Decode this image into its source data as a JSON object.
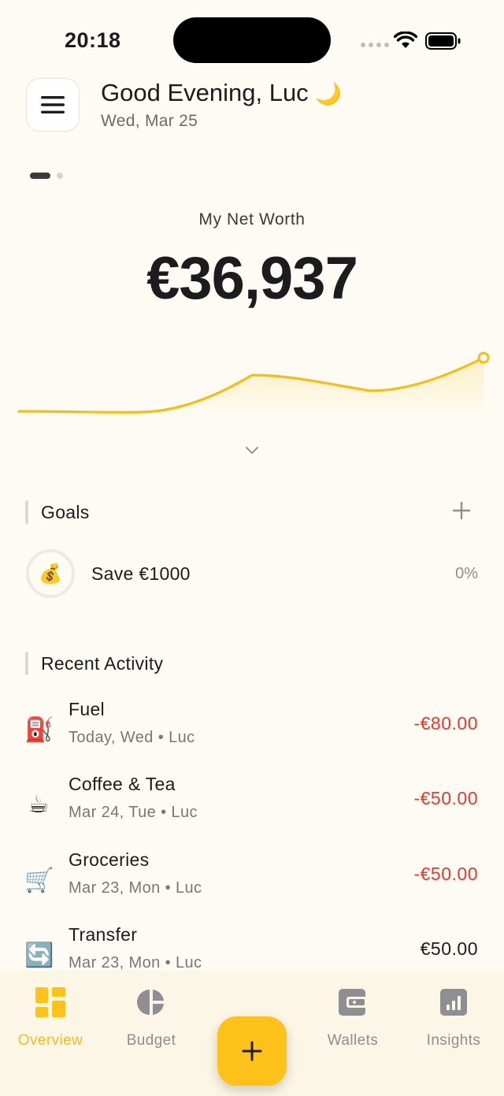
{
  "status": {
    "time": "20:18"
  },
  "header": {
    "greeting": "Good Evening, Luc",
    "moon": "🌙",
    "date": "Wed, Mar 25"
  },
  "net_worth": {
    "label": "My Net Worth",
    "value": "€36,937"
  },
  "goals": {
    "title": "Goals",
    "items": [
      {
        "icon": "💰",
        "name": "Save €1000",
        "progress": "0%"
      }
    ]
  },
  "activity": {
    "title": "Recent Activity",
    "items": [
      {
        "icon": "⛽",
        "title": "Fuel",
        "subtitle": "Today, Wed • Luc",
        "amount": "-€80.00"
      },
      {
        "icon": "☕",
        "title": "Coffee & Tea",
        "subtitle": "Mar 24, Tue • Luc",
        "amount": "-€50.00"
      },
      {
        "icon": "🛒",
        "title": "Groceries",
        "subtitle": "Mar 23, Mon • Luc",
        "amount": "-€50.00"
      },
      {
        "icon": "🔄",
        "title": "Transfer",
        "subtitle": "Mar 23, Mon • Luc",
        "amount": "€50.00"
      }
    ]
  },
  "tabs": [
    {
      "label": "Overview",
      "active": true
    },
    {
      "label": "Budget"
    },
    {
      "label": "Wallets"
    },
    {
      "label": "Insights"
    }
  ],
  "fab": {
    "icon": "plus-icon"
  },
  "colors": {
    "accent": "#FFC21A",
    "negative": "#E8392E",
    "background": "#FDFBF4"
  }
}
